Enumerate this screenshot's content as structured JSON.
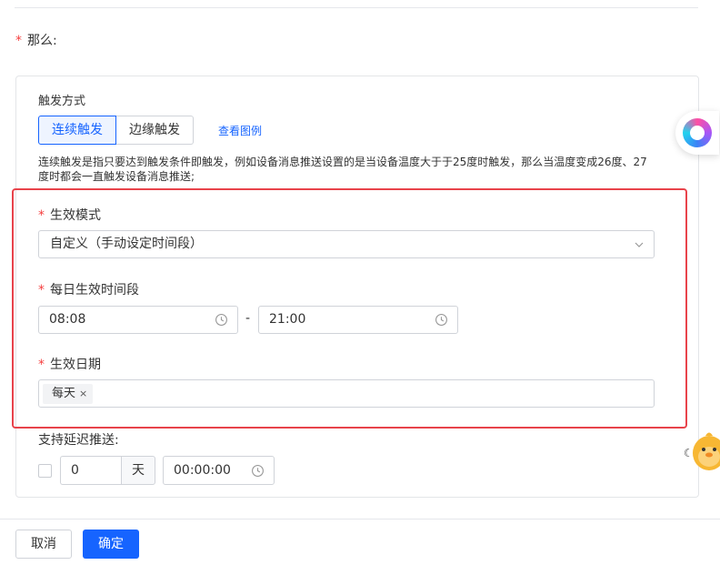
{
  "section": {
    "required_mark": "*",
    "label": "那么:"
  },
  "trigger": {
    "title": "触发方式",
    "options": [
      "连续触发",
      "边缘触发"
    ],
    "selected": "连续触发",
    "example_link": "查看图例",
    "description": "连续触发是指只要达到触发条件即触发，例如设备消息推送设置的是当设备温度大于于25度时触发，那么当温度变成26度、27度时都会一直触发设备消息推送;"
  },
  "effect_mode": {
    "required_mark": "*",
    "label": "生效模式",
    "value": "自定义（手动设定时间段）"
  },
  "daily_period": {
    "required_mark": "*",
    "label": "每日生效时间段",
    "start": "08:08",
    "separator": "-",
    "end": "21:00"
  },
  "effect_date": {
    "required_mark": "*",
    "label": "生效日期",
    "tags": [
      "每天"
    ],
    "tag_remove": "×"
  },
  "delay": {
    "label": "支持延迟推送:",
    "days_value": "0",
    "days_unit": "天",
    "time_value": "00:00:00"
  },
  "footer": {
    "cancel": "取消",
    "confirm": "确定"
  },
  "icons": {
    "select_chevron": "chevron-down-icon",
    "clock": "clock-icon",
    "assistant": "assistant-logo-icon",
    "mascot": "mascot-icon"
  },
  "colors": {
    "primary": "#1664ff",
    "required": "#f53f3f",
    "highlight_border": "#e8434b"
  }
}
